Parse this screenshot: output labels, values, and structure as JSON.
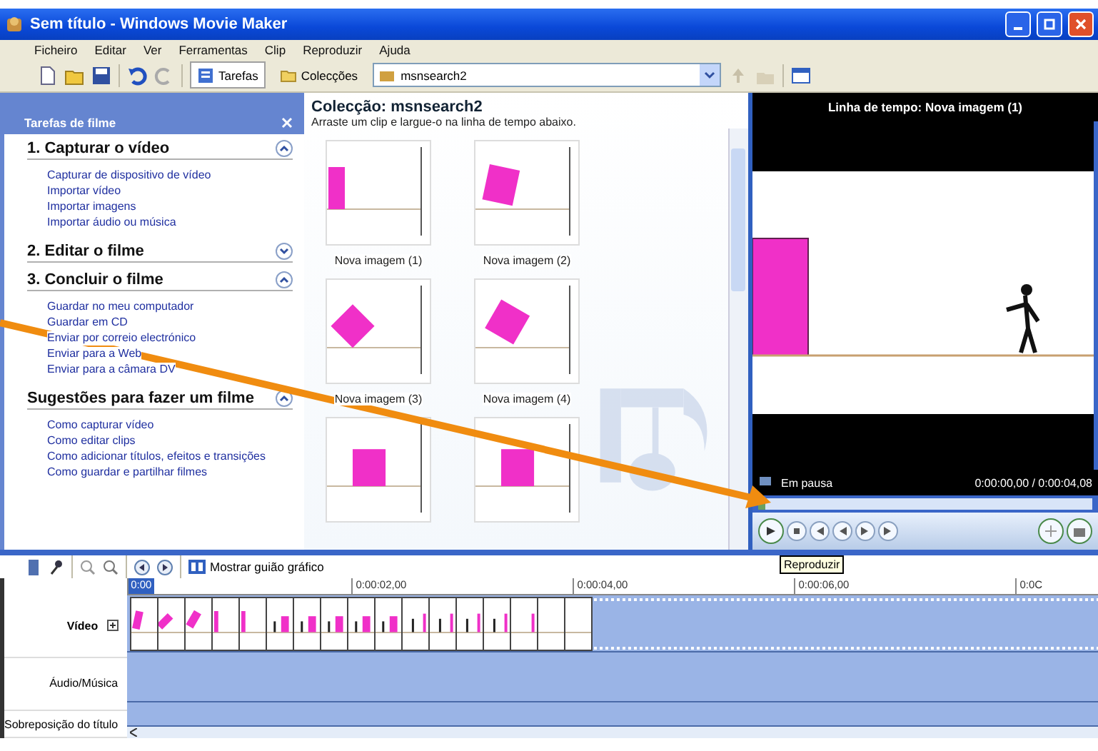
{
  "window": {
    "title": "Sem título - Windows Movie Maker"
  },
  "menu": [
    "Ficheiro",
    "Editar",
    "Ver",
    "Ferramentas",
    "Clip",
    "Reproduzir",
    "Ajuda"
  ],
  "toolbar": {
    "tabs": [
      {
        "label": "Tarefas",
        "selected": true
      },
      {
        "label": "Colecções",
        "selected": false
      }
    ],
    "collection_box": {
      "value": "msnsearch2"
    }
  },
  "tasks_pane": {
    "title": "Tarefas de filme",
    "sections": [
      {
        "title": "1. Capturar o vídeo",
        "expanded": true,
        "items": [
          "Capturar de dispositivo de vídeo",
          "Importar vídeo",
          "Importar imagens",
          "Importar áudio ou música"
        ]
      },
      {
        "title": "2. Editar o filme",
        "expanded": false
      },
      {
        "title": "3. Concluir o filme",
        "expanded": true,
        "items": [
          "Guardar no meu computador",
          "Guardar em CD",
          "Enviar por correio electrónico",
          "Enviar para a Web",
          "Enviar para a câmara DV"
        ]
      },
      {
        "title": "Sugestões para fazer um filme",
        "expanded": true,
        "items": [
          "Como capturar vídeo",
          "Como editar clips",
          "Como adicionar títulos, efeitos e transições",
          "Como guardar e partilhar filmes"
        ]
      }
    ]
  },
  "collection": {
    "title": "Colecção: msnsearch2",
    "hint": "Arraste um clip e largue-o na linha de tempo abaixo.",
    "clips": [
      {
        "kind": "bar",
        "label": "Nova imagem (1)"
      },
      {
        "kind": "tilted",
        "label": "Nova imagem (2)"
      },
      {
        "kind": "diamond",
        "label": "Nova imagem (3)"
      },
      {
        "kind": "tilted2",
        "label": "Nova imagem (4)"
      },
      {
        "kind": "square"
      },
      {
        "kind": "square"
      }
    ]
  },
  "preview": {
    "title": "Linha de tempo: Nova imagem (1)",
    "status": "Em pausa",
    "time": "0:00:00,00 / 0:00:04,08",
    "level": 0.0,
    "tooltip": "Reproduzir"
  },
  "timeline": {
    "storyboard_button": "Mostrar guião gráfico",
    "ruler": [
      "0:00",
      "0:00:02,00",
      "0:00:04,00",
      "0:00:06,00",
      "0:0C"
    ],
    "tracks": [
      {
        "label": "Vídeo",
        "kind": "video"
      },
      {
        "label": "Áudio/Música",
        "kind": "audio"
      },
      {
        "label": "Sobreposição do título",
        "kind": "title"
      }
    ],
    "frames": [
      {
        "kind": "tilted"
      },
      {
        "kind": "diamond"
      },
      {
        "kind": "tilted2"
      },
      {
        "kind": "bar"
      },
      {
        "kind": "bar"
      },
      {
        "kind": "figbar"
      },
      {
        "kind": "figbar"
      },
      {
        "kind": "figbar"
      },
      {
        "kind": "figbar"
      },
      {
        "kind": "figbar"
      },
      {
        "kind": "fig"
      },
      {
        "kind": "fig"
      },
      {
        "kind": "fig"
      },
      {
        "kind": "fig"
      },
      {
        "kind": "line"
      },
      {
        "kind": "blank"
      },
      {
        "kind": "blank"
      }
    ]
  }
}
